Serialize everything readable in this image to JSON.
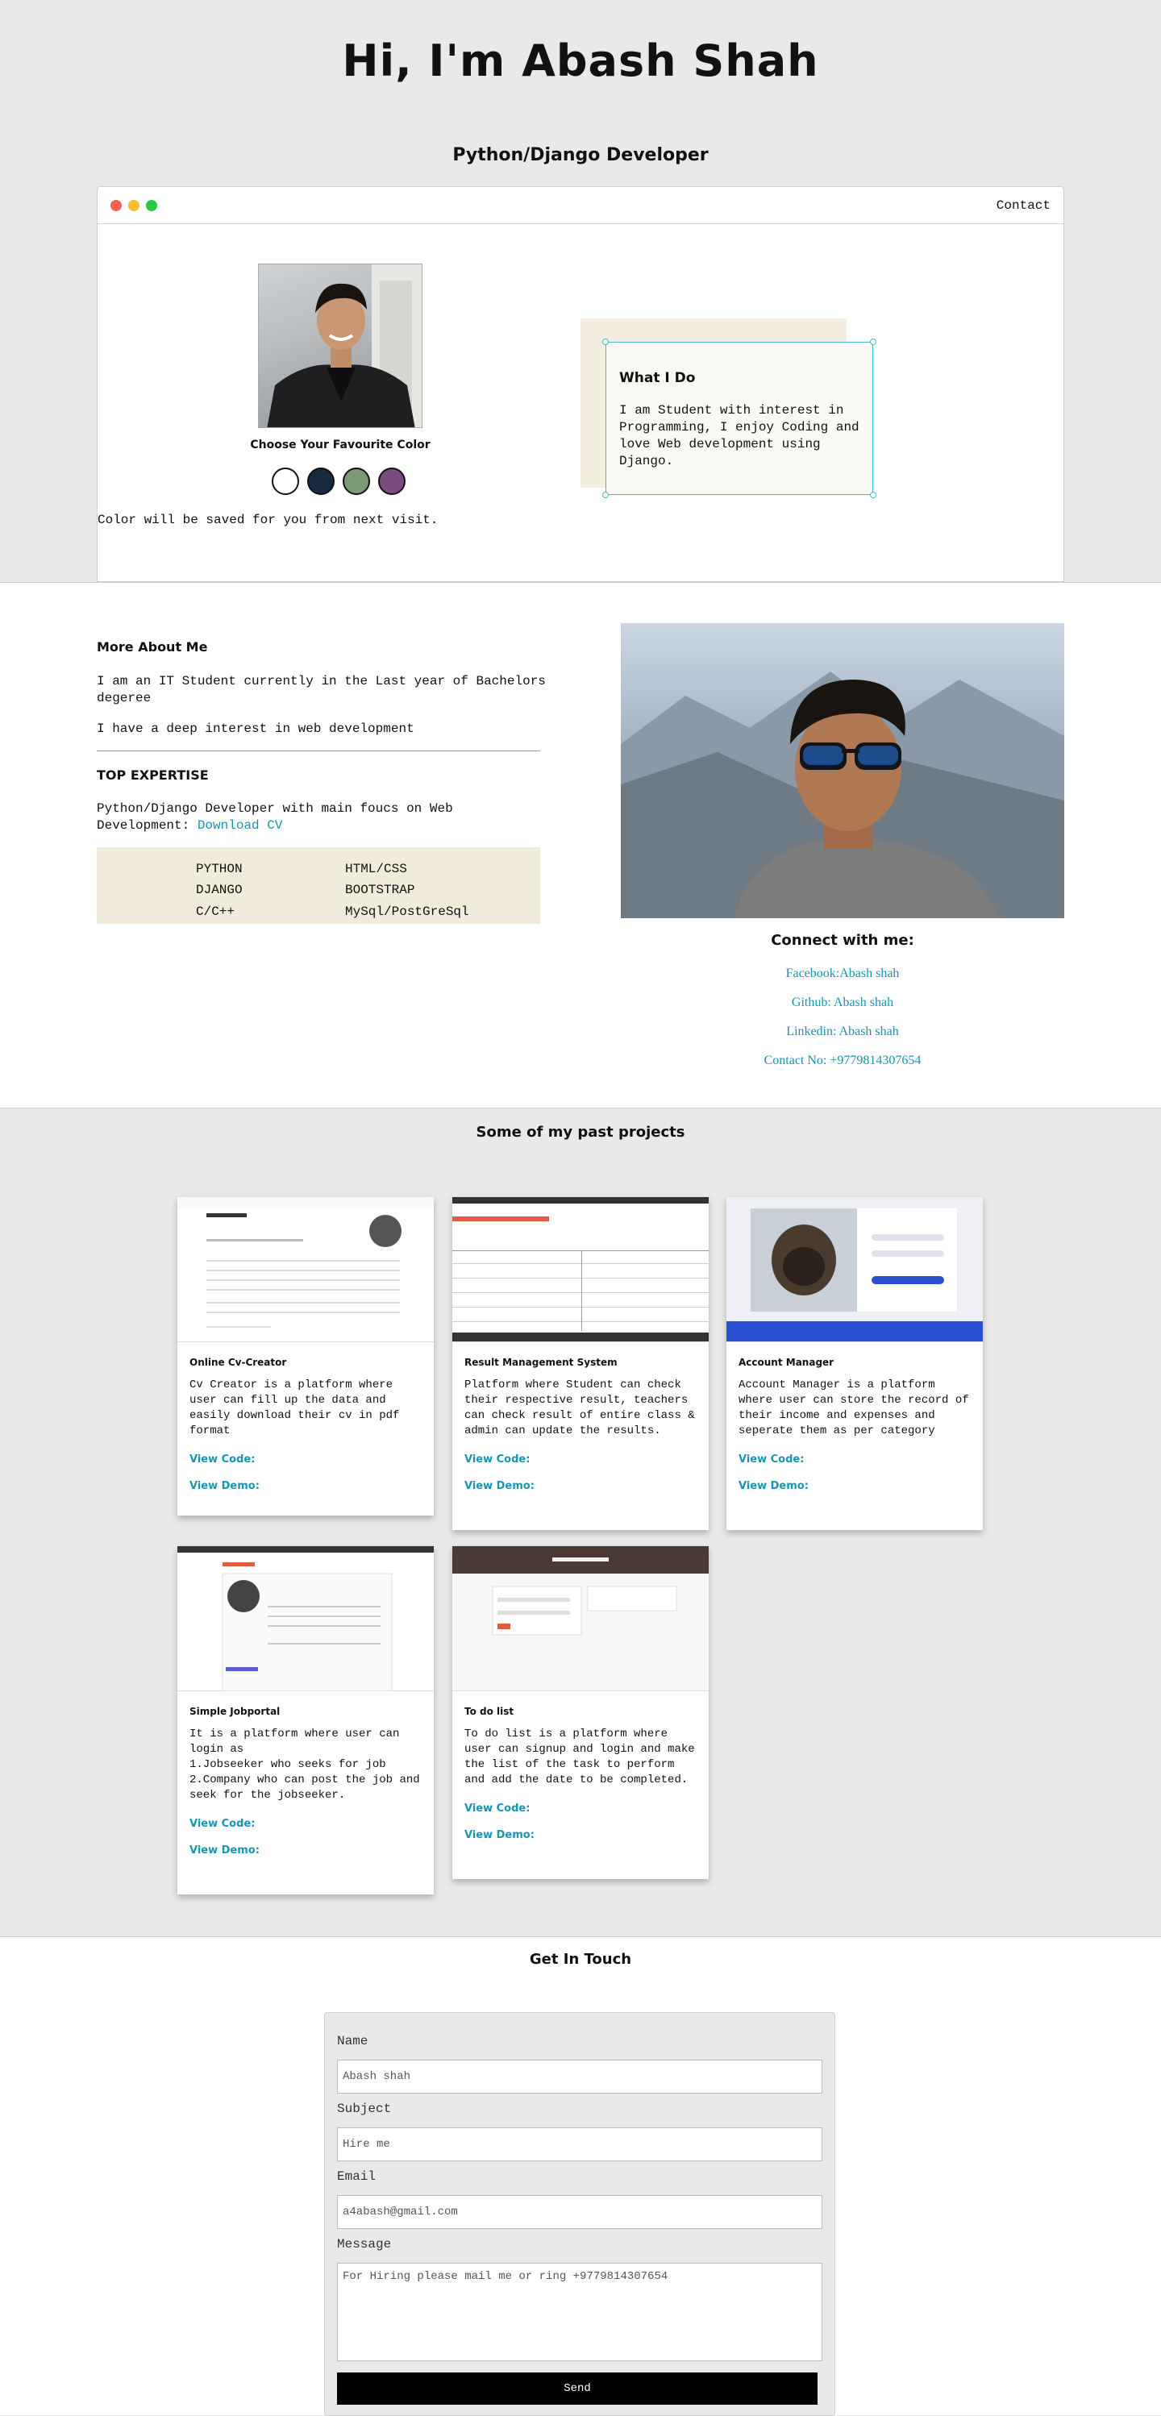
{
  "hero": {
    "title": "Hi, I'm Abash Shah",
    "subtitle": "Python/Django Developer",
    "contact_link": "Contact",
    "favourite_color_label": "Choose Your Favourite Color",
    "color_options": [
      "#ffffff",
      "#17293d",
      "#7d9a76",
      "#7a4a80"
    ],
    "color_note": "Color will be saved for you from next visit.",
    "what_i_do": {
      "title": "What I Do",
      "text": "I am Student with interest in Programming, I enjoy Coding and love Web development using Django."
    }
  },
  "about": {
    "heading": "More About Me",
    "para1": "I am an IT Student currently in the Last year of Bachelors degeree",
    "para2": "I have a deep interest in web development",
    "expertise_heading": "TOP EXPERTISE",
    "expertise_text": "Python/Django Developer with main foucs on Web Development: ",
    "download_cv": "Download CV",
    "skills_left": [
      "PYTHON",
      "DJANGO",
      "C/C++"
    ],
    "skills_right": [
      "HTML/CSS",
      "BOOTSTRAP",
      "MySql/PostGreSql"
    ],
    "connect_title": "Connect with me:",
    "connect_links": [
      "Facebook:Abash shah",
      "Github: Abash shah",
      "Linkedin: Abash shah",
      "Contact No: +9779814307654"
    ]
  },
  "projects": {
    "heading": "Some of my past projects",
    "view_code": "View Code:",
    "view_demo": "View Demo:",
    "items": [
      {
        "title": "Online Cv-Creator",
        "desc": "Cv Creator is a platform where user can fill up the data and easily download their cv in pdf format"
      },
      {
        "title": "Result Management System",
        "desc": "Platform where Student can check their respective result, teachers can check result of entire class & admin can update the results."
      },
      {
        "title": "Account Manager",
        "desc": "Account Manager is a platform where user can store the record of their income and expenses and seperate them as per category"
      },
      {
        "title": "Simple Jobportal",
        "desc": "It is a platform where user can login as\n1.Jobseeker who seeks for job\n2.Company who can post the job and seek for the jobseeker."
      },
      {
        "title": "To do list",
        "desc": "To do list is a platform where user can signup and login and make the list of the task to perform and add the date to be completed."
      }
    ]
  },
  "contact": {
    "heading": "Get In Touch",
    "name_label": "Name",
    "name_value": "Abash shah",
    "subject_label": "Subject",
    "subject_value": "Hire me",
    "email_label": "Email",
    "email_value": "a4abash@gmail.com",
    "message_label": "Message",
    "message_value": "For Hiring please mail me or ring +9779814307654",
    "send_label": "Send"
  }
}
